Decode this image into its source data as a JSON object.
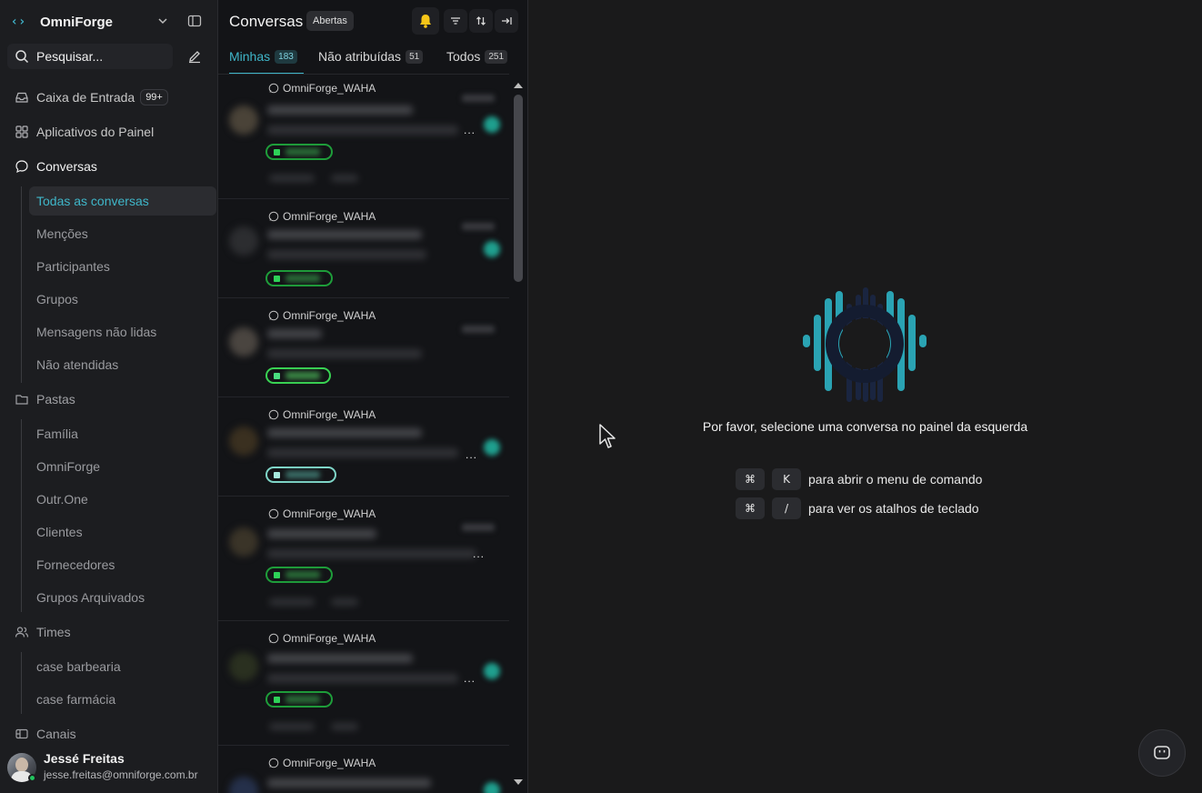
{
  "brand": {
    "name": "OmniForge"
  },
  "search": {
    "placeholder": "Pesquisar..."
  },
  "nav": {
    "inbox": {
      "label": "Caixa de Entrada",
      "badge": "99+"
    },
    "dashboard_apps": {
      "label": "Aplicativos do Painel"
    },
    "conversations": {
      "label": "Conversas",
      "items": [
        "Todas as conversas",
        "Menções",
        "Participantes",
        "Grupos",
        "Mensagens não lidas",
        "Não atendidas"
      ]
    },
    "folders": {
      "label": "Pastas",
      "items": [
        "Família",
        "OmniForge",
        "Outr.One",
        "Clientes",
        "Fornecedores",
        "Grupos Arquivados"
      ]
    },
    "teams": {
      "label": "Times",
      "items": [
        "case barbearia",
        "case farmácia"
      ]
    },
    "channels": {
      "label": "Canais"
    }
  },
  "user": {
    "name": "Jessé Freitas",
    "email": "jesse.freitas@omniforge.com.br"
  },
  "list": {
    "title": "Conversas",
    "status": "Abertas",
    "tabs": [
      {
        "label": "Minhas",
        "count": "183"
      },
      {
        "label": "Não atribuídas",
        "count": "51"
      },
      {
        "label": "Todos",
        "count": "251"
      }
    ],
    "inbox_name": "OmniForge_WAHA",
    "more": "..."
  },
  "main": {
    "empty_message": "Por favor, selecione uma conversa no painel da esquerda",
    "shortcuts": [
      {
        "key1": "⌘",
        "key2": "K",
        "desc": "para abrir o menu de comando"
      },
      {
        "key1": "⌘",
        "key2": "/",
        "desc": "para ver os atalhos de teclado"
      }
    ]
  },
  "colors": {
    "accent": "#3fb6c9",
    "label_green": "#2ed158",
    "bg": "#1a1a1b"
  }
}
